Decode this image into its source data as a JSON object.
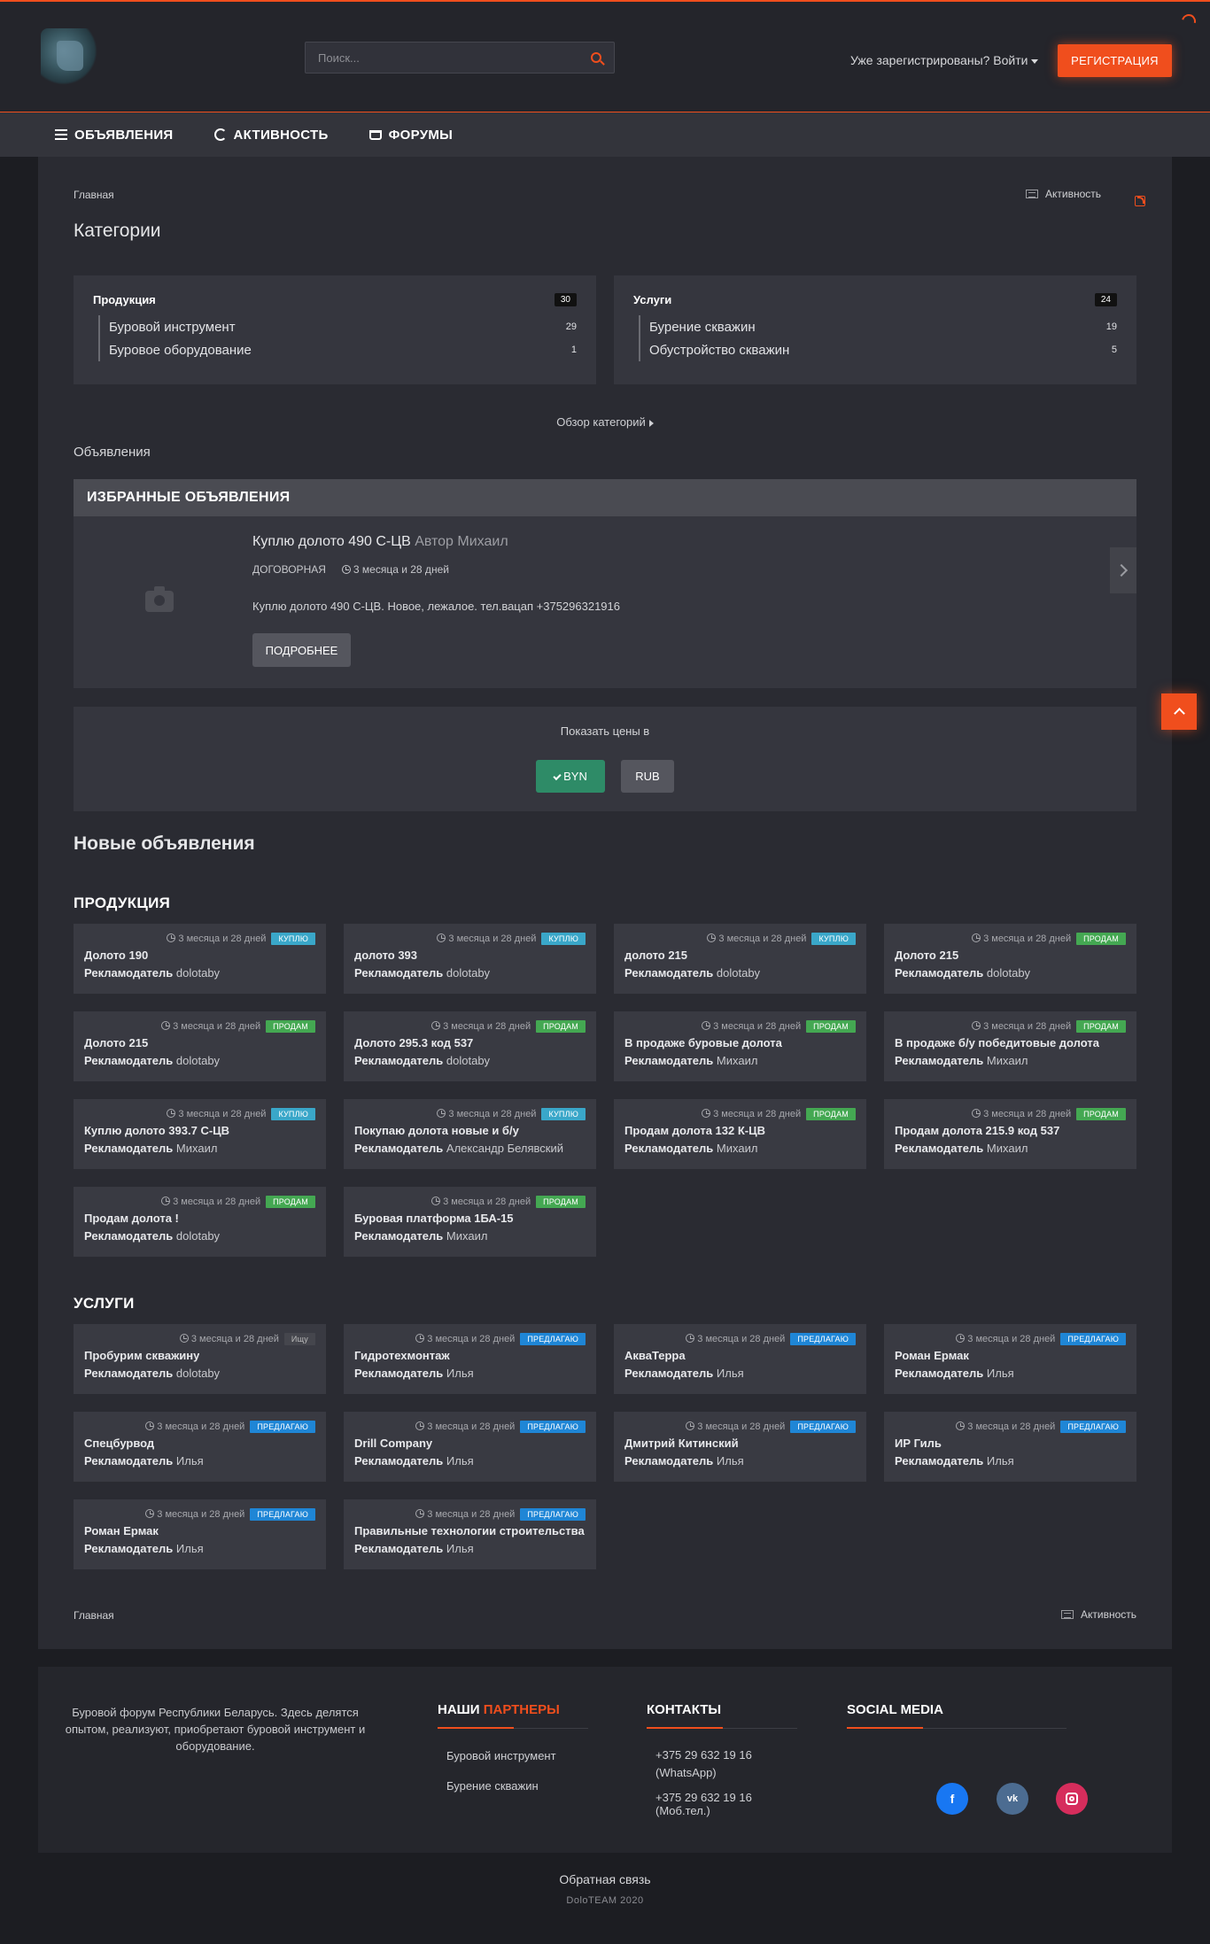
{
  "header": {
    "search_placeholder": "Поиск...",
    "login": "Уже зарегистрированы? Войти",
    "register": "РЕГИСТРАЦИЯ"
  },
  "nav": [
    {
      "label": "ОБЪЯВЛЕНИЯ",
      "icon": "list-icon"
    },
    {
      "label": "АКТИВНОСТЬ",
      "icon": "activity-icon"
    },
    {
      "label": "ФОРУМЫ",
      "icon": "cart-icon"
    }
  ],
  "breadcrumb": "Главная",
  "activity_link": "Активность",
  "page_title": "Категории",
  "categories": [
    {
      "name": "Продукция",
      "count": "30",
      "items": [
        {
          "name": "Буровой инструмент",
          "count": "29"
        },
        {
          "name": "Буровое оборудование",
          "count": "1"
        }
      ]
    },
    {
      "name": "Услуги",
      "count": "24",
      "items": [
        {
          "name": "Бурение скважин",
          "count": "19"
        },
        {
          "name": "Обустройство скважин",
          "count": "5"
        }
      ]
    }
  ],
  "browse_categories": "Обзор категорий",
  "section_label": "Объявления",
  "featured": {
    "heading": "ИЗБРАННЫЕ ОБЪЯВЛЕНИЯ",
    "title": "Куплю долото 490 С-ЦВ",
    "author": "Автор Михаил",
    "price": "ДОГОВОРНАЯ",
    "time": "3 месяца и 28 дней",
    "description": "Куплю долото 490 С-ЦВ. Новое, лежалое. тел.вацап +375296321916",
    "more": "ПОДРОБНЕЕ"
  },
  "currency": {
    "label": "Показать цены в",
    "byn": "BYN",
    "rub": "RUB"
  },
  "new_ads_title": "Новые объявления",
  "author_label": "Рекламодатель",
  "groups": [
    {
      "title": "ПРОДУКЦИЯ",
      "ads": [
        {
          "title": "Долото 190",
          "author": "dolotaby",
          "time": "3 месяца и 28 дней",
          "tag": "КУПЛЮ",
          "type": "buy"
        },
        {
          "title": "долото 393",
          "author": "dolotaby",
          "time": "3 месяца и 28 дней",
          "tag": "КУПЛЮ",
          "type": "buy"
        },
        {
          "title": "долото 215",
          "author": "dolotaby",
          "time": "3 месяца и 28 дней",
          "tag": "КУПЛЮ",
          "type": "buy"
        },
        {
          "title": "Долото 215",
          "author": "dolotaby",
          "time": "3 месяца и 28 дней",
          "tag": "ПРОДАМ",
          "type": "sell"
        },
        {
          "title": "Долото 215",
          "author": "dolotaby",
          "time": "3 месяца и 28 дней",
          "tag": "ПРОДАМ",
          "type": "sell"
        },
        {
          "title": "Долото 295.3 код 537",
          "author": "dolotaby",
          "time": "3 месяца и 28 дней",
          "tag": "ПРОДАМ",
          "type": "sell"
        },
        {
          "title": "В продаже буровые долота",
          "author": "Михаил",
          "time": "3 месяца и 28 дней",
          "tag": "ПРОДАМ",
          "type": "sell"
        },
        {
          "title": "В продаже б/у победитовые долота",
          "author": "Михаил",
          "time": "3 месяца и 28 дней",
          "tag": "ПРОДАМ",
          "type": "sell"
        },
        {
          "title": "Куплю долото 393.7 С-ЦВ",
          "author": "Михаил",
          "time": "3 месяца и 28 дней",
          "tag": "КУПЛЮ",
          "type": "buy"
        },
        {
          "title": "Покупаю долота новые и б/у",
          "author": "Александр Белявский",
          "time": "3 месяца и 28 дней",
          "tag": "КУПЛЮ",
          "type": "buy"
        },
        {
          "title": "Продам долота 132 К-ЦВ",
          "author": "Михаил",
          "time": "3 месяца и 28 дней",
          "tag": "ПРОДАМ",
          "type": "sell"
        },
        {
          "title": "Продам долота 215.9 код 537",
          "author": "Михаил",
          "time": "3 месяца и 28 дней",
          "tag": "ПРОДАМ",
          "type": "sell"
        },
        {
          "title": "Продам долота !",
          "author": "dolotaby",
          "time": "3 месяца и 28 дней",
          "tag": "ПРОДАМ",
          "type": "sell"
        },
        {
          "title": "Буровая платформа 1БА-15",
          "author": "Михаил",
          "time": "3 месяца и 28 дней",
          "tag": "ПРОДАМ",
          "type": "sell"
        }
      ]
    },
    {
      "title": "УСЛУГИ",
      "ads": [
        {
          "title": "Пробурим скважину",
          "author": "dolotaby",
          "time": "3 месяца и 28 дней",
          "tag": "Ищу",
          "type": "seek"
        },
        {
          "title": "Гидротехмонтаж",
          "author": "Илья",
          "time": "3 месяца и 28 дней",
          "tag": "ПРЕДЛАГАЮ",
          "type": "offer"
        },
        {
          "title": "АкваТерра",
          "author": "Илья",
          "time": "3 месяца и 28 дней",
          "tag": "ПРЕДЛАГАЮ",
          "type": "offer"
        },
        {
          "title": "Роман Ермак",
          "author": "Илья",
          "time": "3 месяца и 28 дней",
          "tag": "ПРЕДЛАГАЮ",
          "type": "offer"
        },
        {
          "title": "Спецбурвод",
          "author": "Илья",
          "time": "3 месяца и 28 дней",
          "tag": "ПРЕДЛАГАЮ",
          "type": "offer"
        },
        {
          "title": "Drill Company",
          "author": "Илья",
          "time": "3 месяца и 28 дней",
          "tag": "ПРЕДЛАГАЮ",
          "type": "offer"
        },
        {
          "title": "Дмитрий Китинский",
          "author": "Илья",
          "time": "3 месяца и 28 дней",
          "tag": "ПРЕДЛАГАЮ",
          "type": "offer"
        },
        {
          "title": "ИР Гиль",
          "author": "Илья",
          "time": "3 месяца и 28 дней",
          "tag": "ПРЕДЛАГАЮ",
          "type": "offer"
        },
        {
          "title": "Роман Ермак",
          "author": "Илья",
          "time": "3 месяца и 28 дней",
          "tag": "ПРЕДЛАГАЮ",
          "type": "offer"
        },
        {
          "title": "Правильные технологии строительства",
          "author": "Илья",
          "time": "3 месяца и 28 дней",
          "tag": "ПРЕДЛАГАЮ",
          "type": "offer"
        }
      ]
    }
  ],
  "footer": {
    "about": "Буровой форум Республики Беларусь. Здесь делятся опытом, реализуют, приобретают буровой инструмент и оборудование.",
    "partners_head_a": "НАШИ",
    "partners_head_b": "ПАРТНЕРЫ",
    "partners": [
      "Буровой инструмент",
      "Бурение скважин"
    ],
    "contacts_head": "КОНТАКТЫ",
    "contact_1": "+375 29 632 19 16 (WhatsApp)",
    "contact_2": "+375 29 632 19 16 (Моб.тел.)",
    "social_head": "SOCIAL MEDIA",
    "social": {
      "facebook": "f",
      "vk": "vk"
    },
    "feedback": "Обратная связь",
    "copyright": "DoloTEAM 2020"
  },
  "colors": {
    "accent": "#f04e1d",
    "buy": "#3aa7c9",
    "sell": "#44a852",
    "offer": "#1f86d6"
  }
}
